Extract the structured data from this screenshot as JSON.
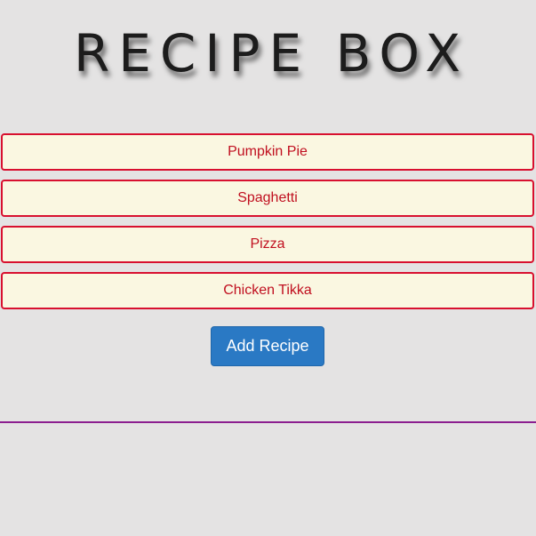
{
  "header": {
    "title": "RECIPE BOX"
  },
  "recipes": [
    {
      "name": "Pumpkin Pie"
    },
    {
      "name": "Spaghetti"
    },
    {
      "name": "Pizza"
    },
    {
      "name": "Chicken Tikka"
    }
  ],
  "actions": {
    "add_label": "Add Recipe"
  },
  "colors": {
    "background": "#e4e3e3",
    "item_background": "#faf7e1",
    "item_border": "#d8102f",
    "item_text": "#c00f1f",
    "button": "#2a79c4",
    "divider": "#8b1e8f"
  }
}
